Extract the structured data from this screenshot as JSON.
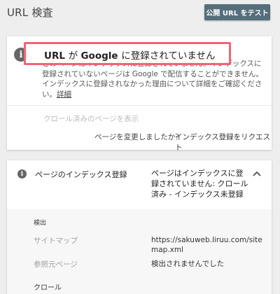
{
  "header": {
    "title": "URL 検査",
    "test_button": "公開 URL をテスト"
  },
  "status_card": {
    "icon": "info-icon",
    "title_parts": [
      "URL ",
      "が ",
      "Google ",
      "に登録されていません"
    ],
    "description_hidden": "このページはインデックスに登録されていません。インデックスに登録されていないページは Google で配信することができません。インデックスに登録されなかった理由について詳細をご確認ください。",
    "detail_link": "詳細",
    "crawled_link": "クロール済みのページを表示",
    "changed_prompt": "ページを変更しましたか？",
    "request_index": "インデックス登録をリクエスト",
    "highlight_color": "#f06475"
  },
  "coverage_card": {
    "icon": "info-icon",
    "title": "ページのインデックス登録",
    "status": "ページはインデックスに登録されていません: クロール済み - インデックス未登録",
    "detection": {
      "heading": "検出",
      "sitemap_label": "サイトマップ",
      "sitemap_value": "https://sakuweb.liruu.com/sitemap.xml",
      "referrer_label": "参照元ページ",
      "referrer_value": "検出されませんでした"
    },
    "crawl_heading": "クロール"
  },
  "colors": {
    "button_bg": "#546e7a",
    "background": "#eeeeee"
  }
}
